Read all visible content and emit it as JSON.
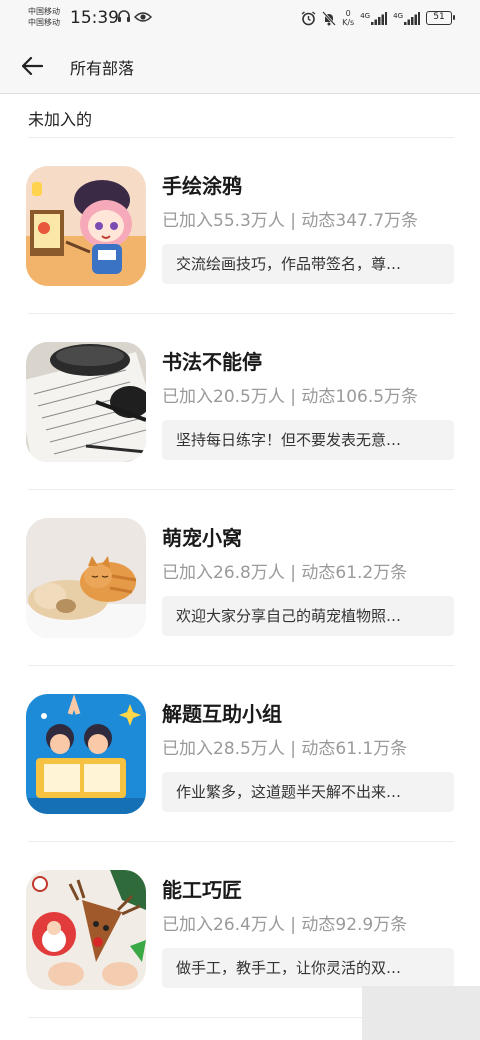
{
  "status_bar": {
    "carrier_1": "中国移动",
    "carrier_2": "中国移动",
    "time": "15:39",
    "net_speed_value": "0",
    "net_speed_unit": "K/s",
    "network_1": "4G",
    "network_2": "4G",
    "battery": "51"
  },
  "header": {
    "title": "所有部落"
  },
  "section": {
    "title": "未加入的"
  },
  "tribes": [
    {
      "name": "手绘涂鸦",
      "stats": "已加入55.3万人 | 动态347.7万条",
      "desc": "交流绘画技巧，作品带签名，尊…"
    },
    {
      "name": "书法不能停",
      "stats": "已加入20.5万人 | 动态106.5万条",
      "desc": "坚持每日练字！但不要发表无意…"
    },
    {
      "name": "萌宠小窝",
      "stats": "已加入26.8万人 | 动态61.2万条",
      "desc": "欢迎大家分享自己的萌宠植物照…"
    },
    {
      "name": "解题互助小组",
      "stats": "已加入28.5万人 | 动态61.1万条",
      "desc": "作业繁多，这道题半天解不出来…"
    },
    {
      "name": "能工巧匠",
      "stats": "已加入26.4万人 | 动态92.9万条",
      "desc": "做手工，教手工，让你灵活的双…"
    }
  ],
  "icons": {
    "back": "arrow-left-icon",
    "headset": "headset-icon",
    "eye": "eye-icon",
    "alarm": "alarm-icon",
    "mute": "bell-off-icon",
    "signal": "signal-icon",
    "battery": "battery-icon"
  }
}
